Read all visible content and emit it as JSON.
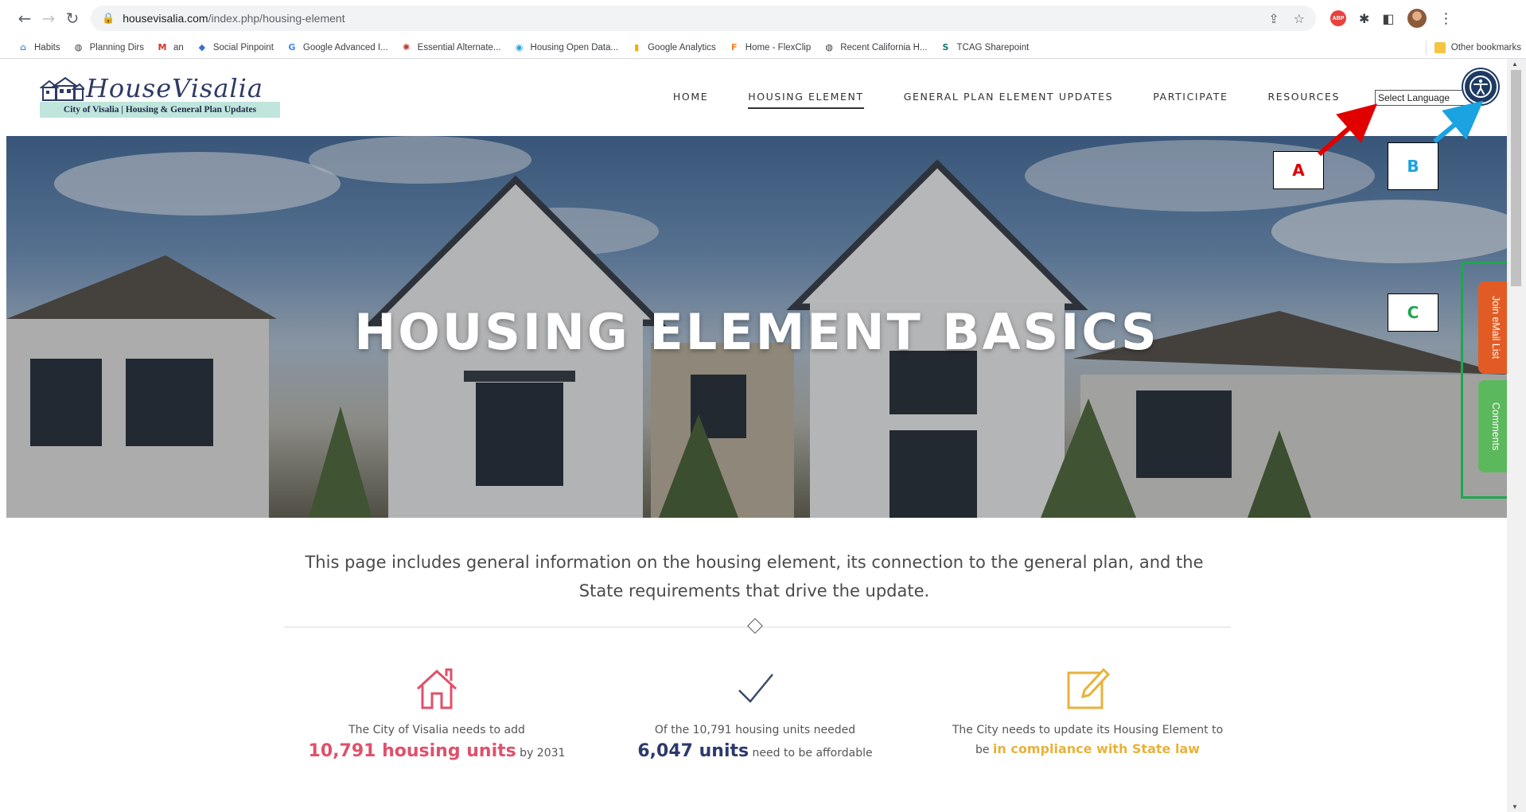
{
  "browser": {
    "url_host": "housevisalia.com",
    "url_path": "/index.php/housing-element",
    "bookmarks": [
      {
        "label": "Habits",
        "icon": "habits-icon",
        "color": "#4a90e2"
      },
      {
        "label": "Planning Dirs",
        "icon": "globe-icon",
        "color": "#3c4043"
      },
      {
        "label": "an",
        "icon": "gmail-icon",
        "color": "#d93025"
      },
      {
        "label": "Social Pinpoint",
        "icon": "pinpoint-icon",
        "color": "#3b6fd1"
      },
      {
        "label": "Google Advanced I...",
        "icon": "google-icon",
        "color": "#4285f4"
      },
      {
        "label": "Essential Alternate...",
        "icon": "ea-icon",
        "color": "#c0392b"
      },
      {
        "label": "Housing Open Data...",
        "icon": "opendata-icon",
        "color": "#2a9fd6"
      },
      {
        "label": "Google Analytics",
        "icon": "analytics-icon",
        "color": "#f9ab00"
      },
      {
        "label": "Home - FlexClip",
        "icon": "flexclip-icon",
        "color": "#f48024"
      },
      {
        "label": "Recent California H...",
        "icon": "globe-icon",
        "color": "#3c4043"
      },
      {
        "label": "TCAG Sharepoint",
        "icon": "sharepoint-icon",
        "color": "#0f7a6b"
      }
    ],
    "other_bookmarks": "Other bookmarks"
  },
  "site": {
    "logo_title": "HouseVisalia",
    "logo_subtitle": "City of Visalia | Housing & General Plan Updates",
    "nav": [
      "HOME",
      "HOUSING ELEMENT",
      "GENERAL PLAN ELEMENT UPDATES",
      "PARTICIPATE",
      "RESOURCES"
    ],
    "active_nav": "HOUSING ELEMENT",
    "language_select": "Select Language",
    "hero_title": "HOUSING ELEMENT BASICS",
    "side_tabs": {
      "email": "Join eMail List",
      "comments": "Comments"
    },
    "intro_line1": "This page includes general information on the housing element, its connection to the general plan, and the",
    "intro_line2": "State requirements that drive the update.",
    "stats": [
      {
        "line1": "The City of Visalia needs to add",
        "highlight": "10,791 housing units",
        "suffix": " by 2031",
        "icon": "house-icon",
        "color": "#e0506a"
      },
      {
        "line1": "Of the 10,791 housing units needed",
        "highlight": "6,047 units",
        "suffix": " need to be affordable",
        "icon": "checkmark-icon",
        "color": "#2c3a6b"
      },
      {
        "line1": "The City needs to update its Housing Element to",
        "prefix": "be ",
        "highlight": "in compliance with State law",
        "icon": "edit-icon",
        "color": "#e8b23a"
      }
    ]
  },
  "annotations": {
    "a": {
      "label": "A",
      "color": "#e00000"
    },
    "b": {
      "label": "B",
      "color": "#1aa3e0"
    },
    "c": {
      "label": "C",
      "color": "#1ea84e"
    }
  }
}
